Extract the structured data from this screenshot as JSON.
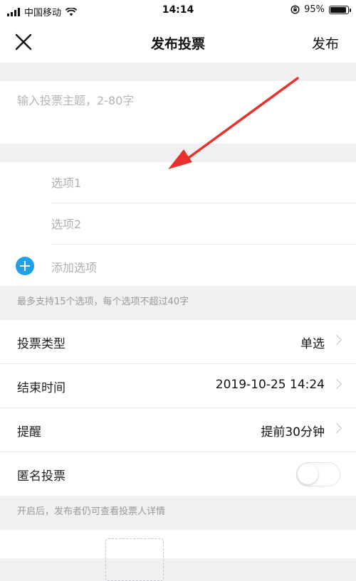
{
  "status_bar": {
    "carrier": "中国移动",
    "time": "14:14",
    "battery": "95%",
    "battery_level": 0.95
  },
  "nav": {
    "title": "发布投票",
    "publish_label": "发布"
  },
  "topic": {
    "placeholder": "输入投票主题，2-80字"
  },
  "options": {
    "items": [
      {
        "placeholder": "选项1"
      },
      {
        "placeholder": "选项2"
      }
    ],
    "add_label": "添加选项",
    "hint": "最多支持15个选项，每个选项不超过40字"
  },
  "settings": {
    "vote_type": {
      "label": "投票类型",
      "value": "单选"
    },
    "end_time": {
      "label": "结束时间",
      "value": "2019-10-25 14:24"
    },
    "reminder": {
      "label": "提醒",
      "value": "提前30分钟"
    },
    "anonymous": {
      "label": "匿名投票",
      "enabled": false
    },
    "hint": "开启后，发布者仍可查看投票人详情"
  },
  "colors": {
    "accent_blue": "#1ea1e6",
    "annotation_red": "#e8302c"
  }
}
